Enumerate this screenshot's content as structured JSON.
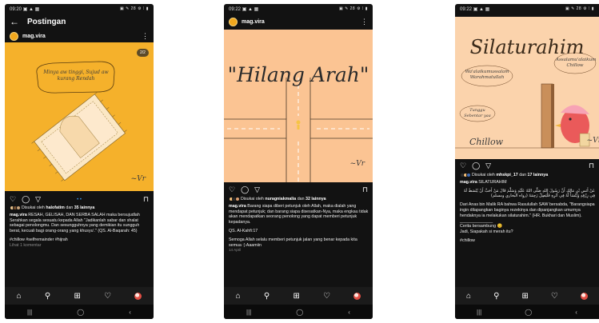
{
  "phone1": {
    "status": {
      "time": "09:20",
      "left_icons": "▣ ▲ ▦",
      "right_icons": "▣ ✎ 28 ⚙ ⁞ ▮"
    },
    "appbar": {
      "back_icon": "←",
      "title": "Postingan"
    },
    "account": "mag.vira",
    "more_icon": "⋮",
    "image": {
      "badge": "2/2",
      "bubble_text": "Minya aw tinggi, Sujud aw kurang Rendah",
      "signature": "~Vr"
    },
    "caption": {
      "liked_prefix": "Disukai oleh",
      "liked_user": "halofatim",
      "liked_mid": "dan",
      "liked_count": "35 lainnya",
      "username": "mag.vira",
      "headline": "RESAH, GELISAH, DAN SERBA SALAH maka bersujudlah",
      "body": "Serahkan segala sesuatu kepada Allah \"Jadikanlah sabar dan shalat sebagai penolongmu. Dan sesungguhnya yang demikian itu sungguh berat, kecuali bagi orang-orang yang khusyu'.\" (QS. Al-Baqarah: 45)",
      "hashtags": "#chillow #selfremainder #hijrah",
      "comments": "Lihat 1 komentar"
    }
  },
  "phone2": {
    "status": {
      "time": "09:22",
      "left_icons": "▣ ▲ ▦",
      "right_icons": "▣ ✎ 28 ⚙ ⁞ ▮"
    },
    "account": "mag.vira",
    "more_icon": "⋮",
    "image": {
      "title": "\"Hilang Arah\"",
      "signature": "~Vr"
    },
    "caption": {
      "liked_prefix": "Disukai oleh",
      "liked_user": "nuragniakmalia",
      "liked_mid": "dan",
      "liked_count": "32 lainnya",
      "username": "mag.vira",
      "body": "Barang siapa diberi petunjuk oleh Allah, maka dialah yang mendapat petunjuk; dan barang siapa disesatkan-Nya, maka engkau tidak akan mendapatkan seorang penolong yang dapat memberi petunjuk kepadanya.",
      "ref": "QS. Al-Kahfi:17",
      "closing": "Semoga Allah selalu memberi petunjuk jalan yang benar kepada kita semua :) Aaamiin",
      "date": "14 April"
    }
  },
  "phone3": {
    "status": {
      "time": "09:22",
      "left_icons": "▣ ▲ ▦",
      "right_icons": "▣ ✎ 28 ⚙ ⁞ ▮"
    },
    "image": {
      "title": "Silaturahim",
      "left_text": "Wa'alaikumussalam Warahmatullah",
      "right_text": "Assalamu'alaikum Chillow",
      "small_text": "Tunggu Sebentar yaa",
      "brand": "Chillow",
      "signature": "~Vr"
    },
    "caption": {
      "liked_prefix": "Disukai oleh",
      "liked_user": "mhskpi_17",
      "liked_mid": "dan",
      "liked_count": "17 lainnya",
      "username": "mag.vira",
      "headline": "SILATURAHIM",
      "arabic": "عَنْ أَنَسِ بْنِ مَالِكٍ أَنَّ رَسُولَ اللهِ صَلَّى اللهُ عَلَيْهِ وَسَلَّمَ قَالَ مَنْ أَحَبَّ أَنْ يُبْسَطَ لَهُ فِي رِزْقِهِ وَيُنْسَأَ لَهُ فِي أَثَرِهِ فَلْيَصِلْ رَحِمَهُ (رواه البخاري ومسلم)",
      "body": "Dari Anas bin Malik RA bahwa Rasulullah SAW bersabda, \"Barangsiapa ingin dilapangkan baginya rezekinya dan dipanjangkan umurnya hendaknya ia melakukan silaturahim.\" (HR. Bukhari dan Muslim).",
      "rule": "______________",
      "line1": "Cerita bersambung 😊",
      "line2": "Jadi, Siapakah si merah itu?",
      "hashtags": "#chillow"
    }
  },
  "icons": {
    "heart": "♡",
    "comment": "◯",
    "share": "▽",
    "bookmark": "⊓",
    "home": "⌂",
    "search": "⚲",
    "add": "⊞",
    "activity": "♡",
    "nav_recent": "|||",
    "nav_home": "◯",
    "nav_back": "‹"
  },
  "colors": {
    "phone1_bg": "#f5b12b",
    "phone2_bg": "#fbc493",
    "phone3_bg": "#fbd3ac",
    "accent_blue": "#3d9bf0"
  }
}
